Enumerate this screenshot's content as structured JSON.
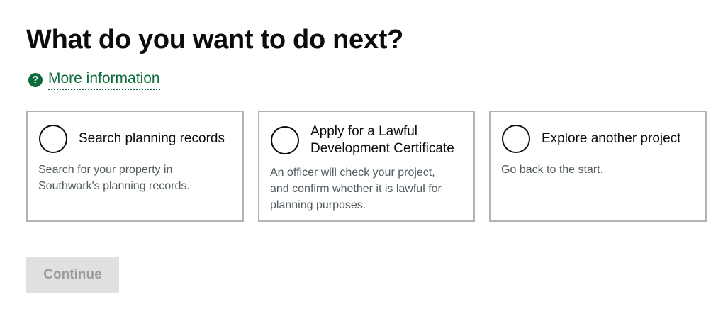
{
  "page": {
    "title": "What do you want to do next?",
    "more_info_label": "More information",
    "help_icon": "?"
  },
  "options": [
    {
      "label": "Search planning records",
      "description": "Search for your property in Southwark's planning records."
    },
    {
      "label_line1": "Apply for a Lawful",
      "label_line2": "Development Certificate",
      "description_line1": "An officer will check your project,",
      "description_line2": "and confirm whether it is lawful for",
      "description_line3": "planning purposes."
    },
    {
      "label": "Explore another project",
      "description": "Go back to the start."
    }
  ],
  "continue_label": "Continue",
  "colors": {
    "link_green": "#0b6b3a",
    "border_grey": "#b1b4b6",
    "button_disabled_bg": "#e0e0e0",
    "button_disabled_text": "#9c9c9c"
  }
}
